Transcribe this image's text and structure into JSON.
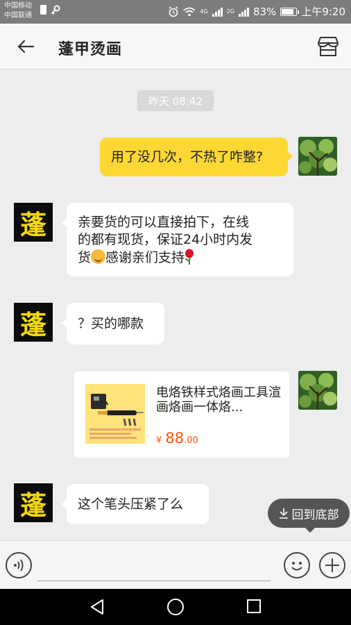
{
  "status_bar": {
    "carrier_1": "中国移动",
    "carrier_2": "中国联通",
    "network_1": "4G",
    "network_2": "2G",
    "battery": "83%",
    "battery_level": 0.83,
    "time": "上午9:20"
  },
  "header": {
    "title": "蓬甲烫画",
    "back_icon": "arrow-left-icon",
    "shop_icon": "store-icon"
  },
  "chat": {
    "time_label": "昨天 08:42",
    "shop_avatar_char": "蓬",
    "messages": [
      {
        "sender": "me",
        "text": "用了没几次，不热了咋整?"
      },
      {
        "sender": "shop",
        "line_1": "亲要货的可以直接拍下，在线",
        "line_2": "的都有现货，保证24小时内发",
        "line_3a": "货",
        "line_3b": "感谢亲们支持"
      },
      {
        "sender": "shop",
        "text": "？买的哪款"
      },
      {
        "sender": "shop",
        "text": "这个笔头压紧了么"
      }
    ],
    "product": {
      "name": "电烙铁样式烙画工具渲画烙画一体烙...",
      "currency": "¥",
      "price_int": "88",
      "price_dec": ".00"
    }
  },
  "back_to_bottom": {
    "label": "回到底部",
    "icon": "arrow-down-icon"
  },
  "input_bar": {
    "voice_icon": "voice-icon",
    "placeholder": "",
    "emoji_icon": "smiley-icon",
    "plus_icon": "plus-icon"
  },
  "colors": {
    "my_bubble": "#fdd835",
    "price": "#ff5000",
    "shop_avatar_bg": "#0c0c0c",
    "shop_avatar_text": "#f4d80a"
  }
}
